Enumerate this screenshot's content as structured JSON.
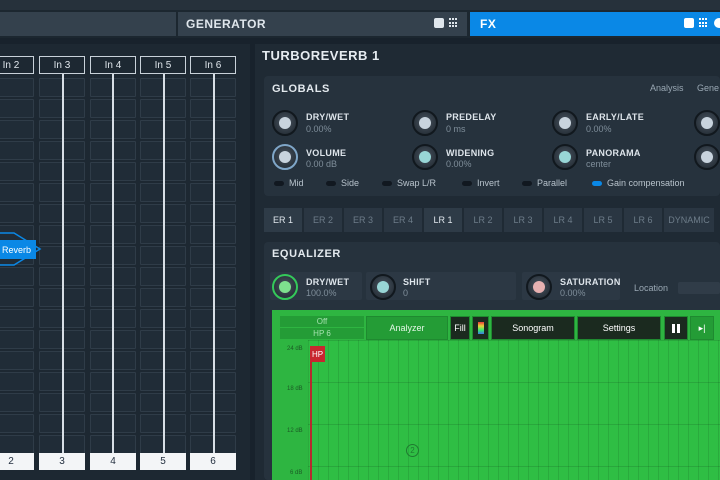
{
  "tabs": {
    "generator": "GENERATOR",
    "fx": "FX"
  },
  "matrix": {
    "inputs": [
      "In 2",
      "In 3",
      "In 4",
      "In 5",
      "In 6"
    ],
    "outputs": [
      "2",
      "3",
      "4",
      "5",
      "6"
    ],
    "node_label": "Reverb"
  },
  "plugin": {
    "title": "TURBOREVERB 1"
  },
  "globals": {
    "title": "GLOBALS",
    "links": [
      "Analysis",
      "Gene"
    ],
    "params": [
      {
        "label": "DRY/WET",
        "value": "0.00%"
      },
      {
        "label": "PREDELAY",
        "value": "0 ms"
      },
      {
        "label": "EARLY/LATE",
        "value": "0.00%"
      },
      {
        "label": "VOLUME",
        "value": "0.00 dB"
      },
      {
        "label": "WIDENING",
        "value": "0.00%"
      },
      {
        "label": "PANORAMA",
        "value": "center"
      }
    ],
    "toggles": [
      {
        "label": "Mid",
        "on": false
      },
      {
        "label": "Side",
        "on": false
      },
      {
        "label": "Swap L/R",
        "on": false
      },
      {
        "label": "Invert",
        "on": false
      },
      {
        "label": "Parallel",
        "on": false
      },
      {
        "label": "Gain compensation",
        "on": true
      }
    ]
  },
  "reflections": {
    "tabs": [
      "ER 1",
      "ER 2",
      "ER 3",
      "ER 4",
      "LR 1",
      "LR 2",
      "LR 3",
      "LR 4",
      "LR 5",
      "LR 6",
      "DYNAMIC"
    ],
    "active": [
      "ER 1",
      "LR 1"
    ]
  },
  "equalizer": {
    "title": "EQUALIZER",
    "params": [
      {
        "label": "DRY/WET",
        "value": "100.0%"
      },
      {
        "label": "SHIFT",
        "value": "0"
      },
      {
        "label": "SATURATION",
        "value": "0.00%"
      }
    ],
    "location_label": "Location",
    "toolbar": {
      "off": "Off",
      "hp": "HP 6",
      "analyzer": "Analyzer",
      "fill": "Fill",
      "sonogram": "Sonogram",
      "settings": "Settings"
    },
    "db_labels": [
      "24 dB",
      "18 dB",
      "12 dB",
      "6 dB"
    ],
    "hp_marker": "HP",
    "band_node": "2"
  },
  "colors": {
    "accent": "#0a88e6",
    "eq_green": "#2fbe44",
    "hp_red": "#c8262f"
  }
}
